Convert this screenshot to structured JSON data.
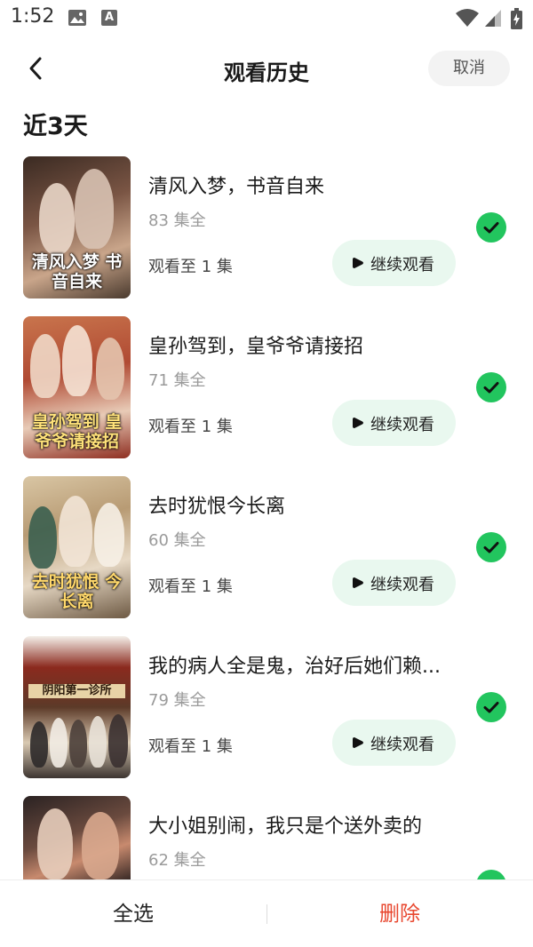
{
  "status_bar": {
    "time": "1:52",
    "notif_letter": "A"
  },
  "header": {
    "title": "观看历史",
    "cancel_label": "取消"
  },
  "section": {
    "title": "近3天"
  },
  "items": [
    {
      "title": "清风入梦，书音自来",
      "episodes": "83 集全",
      "progress": "观看至 1 集",
      "button_label": "继续观看",
      "poster_text": "清风入梦 书音自来",
      "selected": true
    },
    {
      "title": "皇孙驾到，皇爷爷请接招",
      "episodes": "71 集全",
      "progress": "观看至 1 集",
      "button_label": "继续观看",
      "poster_text": "皇孙驾到 皇爷爷请接招",
      "selected": true
    },
    {
      "title": "去时犹恨今长离",
      "episodes": "60 集全",
      "progress": "观看至 1 集",
      "button_label": "继续观看",
      "poster_text": "去时犹恨 今长离",
      "selected": true
    },
    {
      "title": "我的病人全是鬼，治好后她们赖...",
      "episodes": "79 集全",
      "progress": "观看至 1 集",
      "button_label": "继续观看",
      "poster_text": "阴阳第一诊所",
      "selected": true
    },
    {
      "title": "大小姐别闹，我只是个送外卖的",
      "episodes": "62 集全",
      "progress": "",
      "button_label": "",
      "poster_text": "",
      "selected": true
    }
  ],
  "bottom_bar": {
    "select_all_label": "全选",
    "delete_label": "删除"
  },
  "colors": {
    "accent_green": "#22c55e",
    "button_bg": "#e9f8ef",
    "delete_red": "#e8472f"
  }
}
